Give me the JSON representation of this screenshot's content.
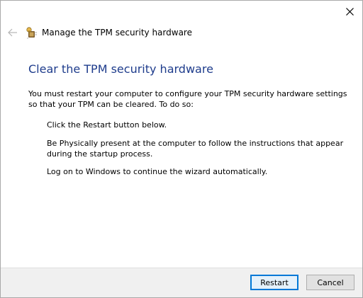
{
  "window": {
    "title": "Manage the TPM security hardware",
    "close_icon": "close-icon",
    "back_icon": "back-arrow-icon",
    "app_icon": "tpm-chip-icon"
  },
  "content": {
    "heading": "Clear the TPM security hardware",
    "intro": "You must restart your computer to configure your TPM security hardware settings so that your TPM can be cleared. To do so:",
    "steps": [
      "Click the Restart button below.",
      "Be Physically present at the computer to follow the instructions that appear during the startup process.",
      "Log on to Windows to continue the wizard automatically."
    ]
  },
  "footer": {
    "restart_label": "Restart",
    "cancel_label": "Cancel"
  },
  "colors": {
    "heading": "#1e3c8c",
    "focus_border": "#0078d7",
    "footer_bg": "#f0f0f0"
  }
}
